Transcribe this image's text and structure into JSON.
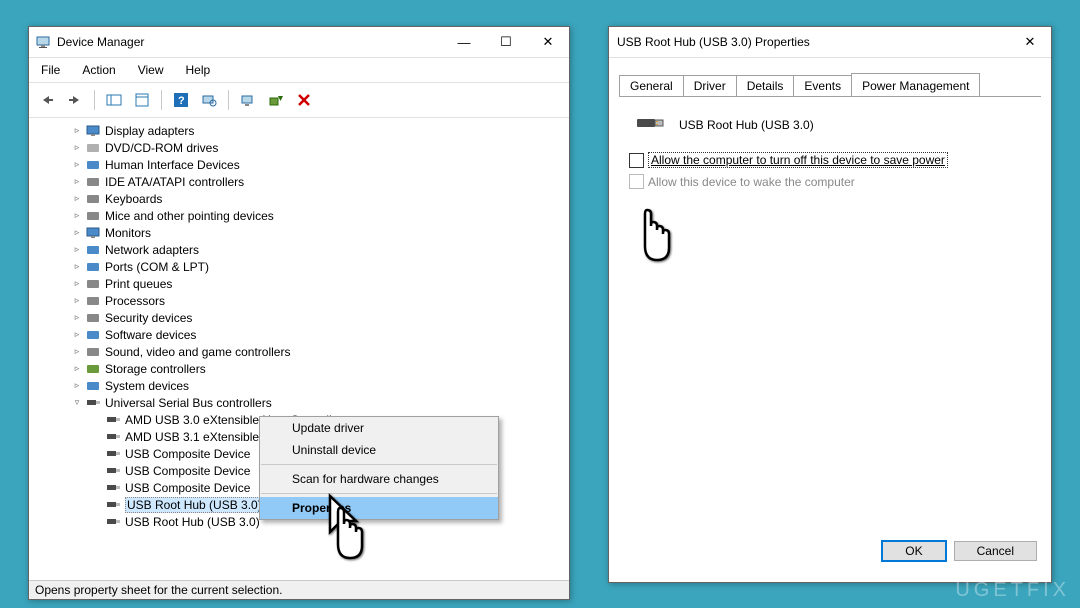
{
  "devmgr": {
    "title": "Device Manager",
    "menu": [
      "File",
      "Action",
      "View",
      "Help"
    ],
    "tree": [
      {
        "exp": ">",
        "icon": "display",
        "label": "Display adapters",
        "indent": 2
      },
      {
        "exp": ">",
        "icon": "disc",
        "label": "DVD/CD-ROM drives",
        "indent": 2
      },
      {
        "exp": ">",
        "icon": "hid",
        "label": "Human Interface Devices",
        "indent": 2
      },
      {
        "exp": ">",
        "icon": "ide",
        "label": "IDE ATA/ATAPI controllers",
        "indent": 2
      },
      {
        "exp": ">",
        "icon": "kbd",
        "label": "Keyboards",
        "indent": 2
      },
      {
        "exp": ">",
        "icon": "mouse",
        "label": "Mice and other pointing devices",
        "indent": 2
      },
      {
        "exp": ">",
        "icon": "monitor",
        "label": "Monitors",
        "indent": 2
      },
      {
        "exp": ">",
        "icon": "net",
        "label": "Network adapters",
        "indent": 2
      },
      {
        "exp": ">",
        "icon": "port",
        "label": "Ports (COM & LPT)",
        "indent": 2
      },
      {
        "exp": ">",
        "icon": "printer",
        "label": "Print queues",
        "indent": 2
      },
      {
        "exp": ">",
        "icon": "cpu",
        "label": "Processors",
        "indent": 2
      },
      {
        "exp": ">",
        "icon": "sec",
        "label": "Security devices",
        "indent": 2
      },
      {
        "exp": ">",
        "icon": "sw",
        "label": "Software devices",
        "indent": 2
      },
      {
        "exp": ">",
        "icon": "sound",
        "label": "Sound, video and game controllers",
        "indent": 2
      },
      {
        "exp": ">",
        "icon": "storage",
        "label": "Storage controllers",
        "indent": 2
      },
      {
        "exp": ">",
        "icon": "sys",
        "label": "System devices",
        "indent": 2
      },
      {
        "exp": "v",
        "icon": "usb",
        "label": "Universal Serial Bus controllers",
        "indent": 2
      },
      {
        "exp": "",
        "icon": "usbdev",
        "label": "AMD USB 3.0 eXtensible Host Controller",
        "indent": 3
      },
      {
        "exp": "",
        "icon": "usbdev",
        "label": "AMD USB 3.1 eXtensible Host Controller",
        "indent": 3
      },
      {
        "exp": "",
        "icon": "usbdev",
        "label": "USB Composite Device",
        "indent": 3
      },
      {
        "exp": "",
        "icon": "usbdev",
        "label": "USB Composite Device",
        "indent": 3
      },
      {
        "exp": "",
        "icon": "usbdev",
        "label": "USB Composite Device",
        "indent": 3
      },
      {
        "exp": "",
        "icon": "usbdev",
        "label": "USB Root Hub (USB 3.0)",
        "indent": 3,
        "sel": true
      },
      {
        "exp": "",
        "icon": "usbdev",
        "label": "USB Root Hub (USB 3.0)",
        "indent": 3
      }
    ],
    "context": {
      "items": [
        "Update driver",
        "Uninstall device",
        "__sep__",
        "Scan for hardware changes",
        "__sep__",
        "Properties"
      ],
      "highlight": "Properties"
    },
    "status": "Opens property sheet for the current selection."
  },
  "props": {
    "title": "USB Root Hub (USB 3.0) Properties",
    "tabs": [
      "General",
      "Driver",
      "Details",
      "Events",
      "Power Management"
    ],
    "active_tab": "Power Management",
    "device_name": "USB Root Hub (USB 3.0)",
    "opt1": "Allow the computer to turn off this device to save power",
    "opt2": "Allow this device to wake the computer",
    "ok": "OK",
    "cancel": "Cancel"
  },
  "watermark": "UGETFIX"
}
